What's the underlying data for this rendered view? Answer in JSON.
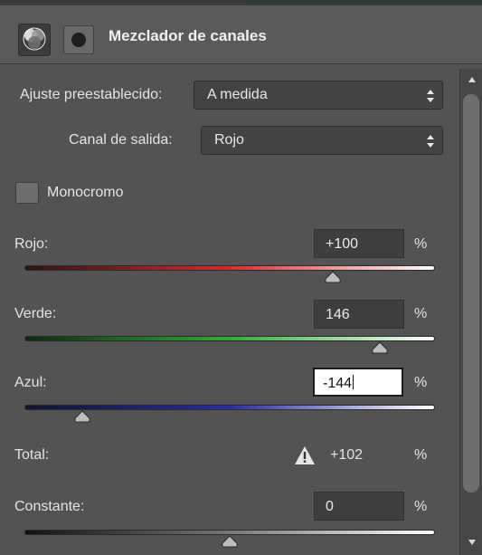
{
  "panel": {
    "title": "Mezclador de canales",
    "header_icons": [
      "adjustment-layer-icon",
      "layer-mask-icon"
    ]
  },
  "preset": {
    "label": "Ajuste preestablecido:",
    "value": "A medida"
  },
  "output_channel": {
    "label": "Canal de salida:",
    "value": "Rojo"
  },
  "monochrome": {
    "label": "Monocromo",
    "checked": false
  },
  "channels": [
    {
      "label": "Rojo:",
      "value": "+100",
      "unit": "%",
      "level": 100,
      "colors": [
        "#2a1212",
        "#d92c2c",
        "#ffffff"
      ]
    },
    {
      "label": "Verde:",
      "value": "146",
      "unit": "%",
      "level": 146,
      "colors": [
        "#0f2a12",
        "#2bb033",
        "#ffffff"
      ]
    },
    {
      "label": "Azul:",
      "value": "-144",
      "unit": "%",
      "level": -144,
      "colors": [
        "#121430",
        "#2a2ca8",
        "#ffffff"
      ]
    }
  ],
  "total": {
    "label": "Total:",
    "value": "+102",
    "unit": "%"
  },
  "constant": {
    "label": "Constante:",
    "value": "0",
    "unit": "%",
    "level": 0
  },
  "colors": {
    "panel_bg": "#535353",
    "field_bg": "#3e3e3e",
    "text": "#e4e4e4"
  }
}
